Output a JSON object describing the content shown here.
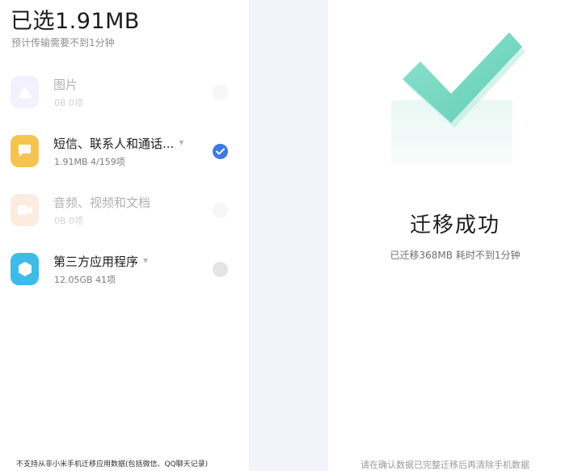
{
  "left_panel": {
    "title": "已选1.91MB",
    "subtitle": "预计传输需要不到1分钟",
    "items": [
      {
        "label": "图片",
        "meta": "0B 0项",
        "selected": false,
        "dimmed": true,
        "icon": "image-icon",
        "color": "#b9b3f5"
      },
      {
        "label": "短信、联系人和通话...",
        "meta": "1.91MB 4/159项",
        "selected": true,
        "dimmed": false,
        "icon": "message-icon",
        "color": "#f5c34f"
      },
      {
        "label": "音频、视频和文档",
        "meta": "0B 0项",
        "selected": false,
        "dimmed": true,
        "icon": "video-icon",
        "color": "#f7a36a"
      },
      {
        "label": "第三方应用程序",
        "meta": "12.05GB 41项",
        "selected": false,
        "dimmed": false,
        "icon": "app-icon",
        "color": "#3dbce8"
      }
    ],
    "footnote": "不支持从非小米手机迁移应用数据(包括微信、QQ聊天记录)"
  },
  "right_panel": {
    "success_title": "迁移成功",
    "success_subtitle": "已迁移368MB 耗时不到1分钟",
    "footnote": "请在确认数据已完整迁移后再清除手机数据",
    "checkmark_color": "#7fd9c4"
  }
}
